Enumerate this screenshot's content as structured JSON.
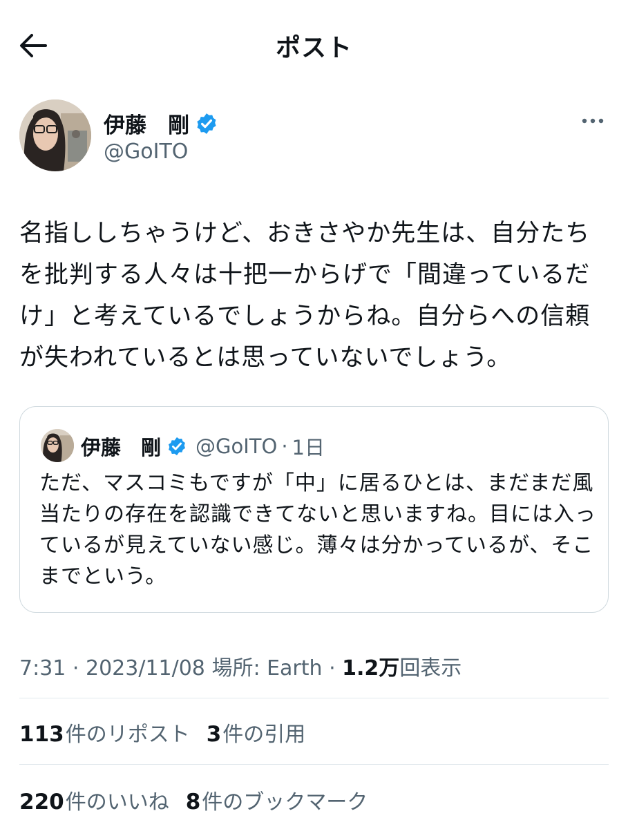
{
  "header": {
    "title": "ポスト"
  },
  "author": {
    "name": "伊藤　剛",
    "handle": "@GoITO"
  },
  "tweet": {
    "text": "名指ししちゃうけど、おきさやか先生は、自分たちを批判する人々は十把一からげで「間違っているだけ」と考えているでしょうからね。自分らへの信頼が失われているとは思っていないでしょう。"
  },
  "quote": {
    "name": "伊藤　剛",
    "handle": "@GoITO",
    "separator": "·",
    "time": "1日",
    "text": "ただ、マスコミもですが「中」に居るひとは、まだまだ風当たりの存在を認識できてないと思いますね。目には入っているが見えていない感じ。薄々は分かっているが、そこまでという。"
  },
  "meta": {
    "time": "7:31",
    "date": "2023/11/08",
    "location_label": "場所: Earth",
    "sep": " · ",
    "views_count": "1.2万",
    "views_label": "回表示"
  },
  "stats": {
    "reposts": {
      "count": "113",
      "label": "件のリポスト"
    },
    "quotes": {
      "count": "3",
      "label": "件の引用"
    },
    "likes": {
      "count": "220",
      "label": "件のいいね"
    },
    "bookmarks": {
      "count": "8",
      "label": "件のブックマーク"
    }
  },
  "colors": {
    "text_primary": "#0f1419",
    "text_secondary": "#536471",
    "verified_blue": "#1d9bf0",
    "border": "#cfd9de"
  }
}
